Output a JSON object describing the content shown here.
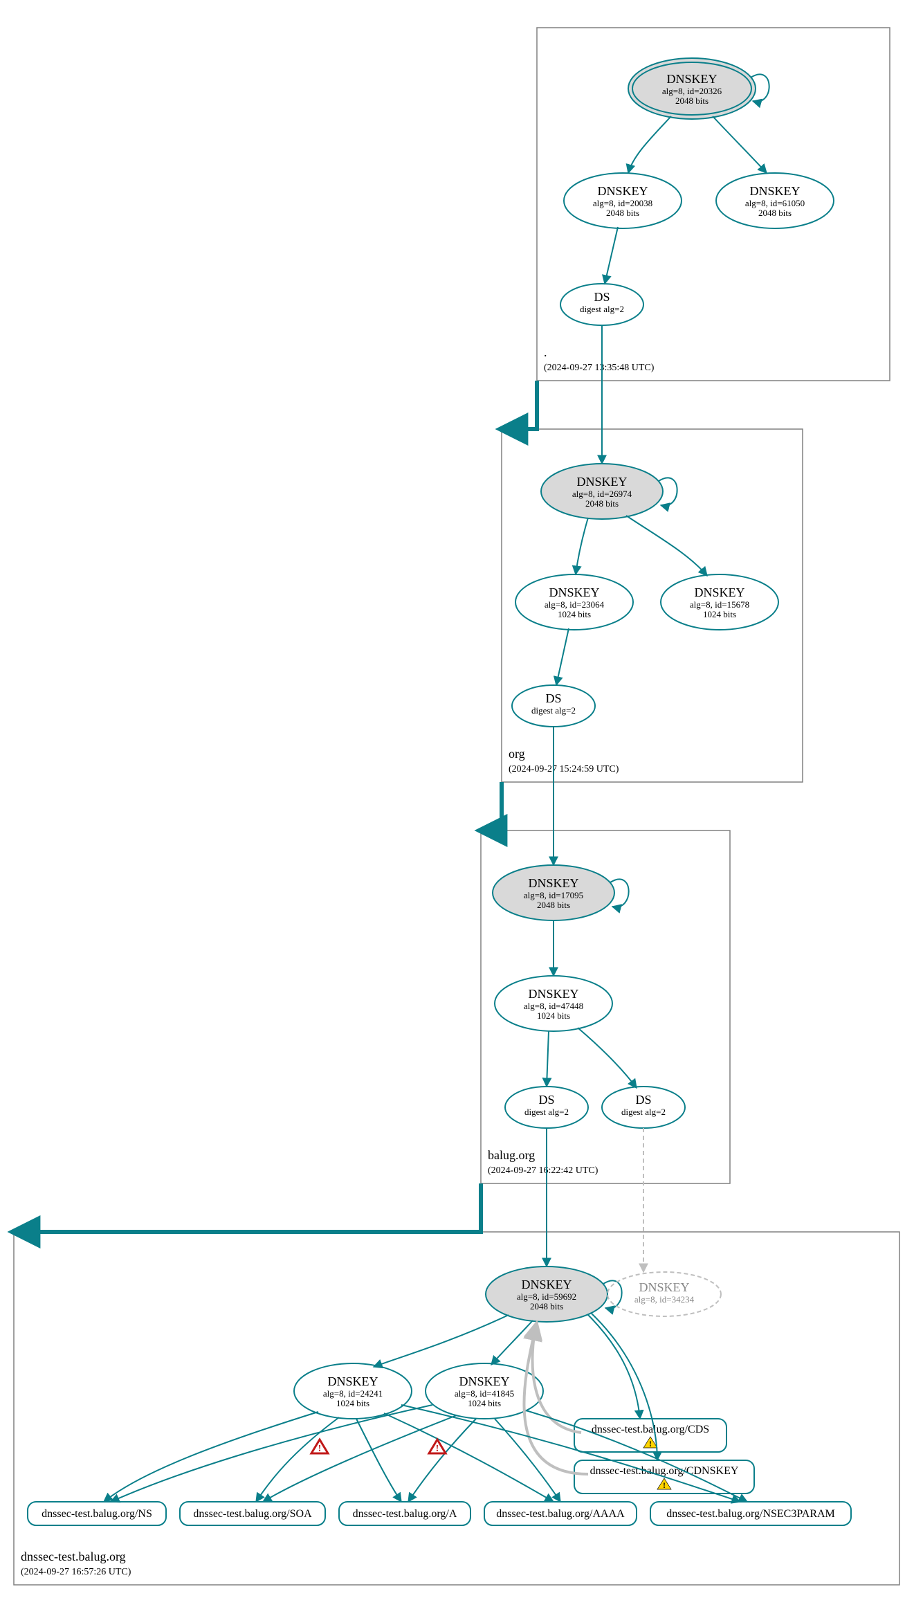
{
  "colors": {
    "teal": "#0a7f8a",
    "grayStroke": "#808080",
    "grayFill": "#d9d9d9",
    "lightGray": "#bfbfbf",
    "red": "#c01818",
    "yellow": "#ffd400"
  },
  "zones": {
    "root": {
      "name": ".",
      "timestamp": "(2024-09-27 13:35:48 UTC)"
    },
    "org": {
      "name": "org",
      "timestamp": "(2024-09-27 15:24:59 UTC)"
    },
    "balug": {
      "name": "balug.org",
      "timestamp": "(2024-09-27 16:22:42 UTC)"
    },
    "dnssec": {
      "name": "dnssec-test.balug.org",
      "timestamp": "(2024-09-27 16:57:26 UTC)"
    }
  },
  "nodes": {
    "root_ksk": {
      "title": "DNSKEY",
      "line2": "alg=8, id=20326",
      "line3": "2048 bits"
    },
    "root_zsk1": {
      "title": "DNSKEY",
      "line2": "alg=8, id=20038",
      "line3": "2048 bits"
    },
    "root_zsk2": {
      "title": "DNSKEY",
      "line2": "alg=8, id=61050",
      "line3": "2048 bits"
    },
    "root_ds": {
      "title": "DS",
      "line2": "digest alg=2"
    },
    "org_ksk": {
      "title": "DNSKEY",
      "line2": "alg=8, id=26974",
      "line3": "2048 bits"
    },
    "org_zsk1": {
      "title": "DNSKEY",
      "line2": "alg=8, id=23064",
      "line3": "1024 bits"
    },
    "org_zsk2": {
      "title": "DNSKEY",
      "line2": "alg=8, id=15678",
      "line3": "1024 bits"
    },
    "org_ds": {
      "title": "DS",
      "line2": "digest alg=2"
    },
    "balug_ksk": {
      "title": "DNSKEY",
      "line2": "alg=8, id=17095",
      "line3": "2048 bits"
    },
    "balug_zsk": {
      "title": "DNSKEY",
      "line2": "alg=8, id=47448",
      "line3": "1024 bits"
    },
    "balug_ds1": {
      "title": "DS",
      "line2": "digest alg=2"
    },
    "balug_ds2": {
      "title": "DS",
      "line2": "digest alg=2"
    },
    "dnssec_ksk": {
      "title": "DNSKEY",
      "line2": "alg=8, id=59692",
      "line3": "2048 bits"
    },
    "dnssec_grey": {
      "title": "DNSKEY",
      "line2": "alg=8, id=34234"
    },
    "dnssec_zsk1": {
      "title": "DNSKEY",
      "line2": "alg=8, id=24241",
      "line3": "1024 bits"
    },
    "dnssec_zsk2": {
      "title": "DNSKEY",
      "line2": "alg=8, id=41845",
      "line3": "1024 bits"
    },
    "rr_cds": {
      "label": "dnssec-test.balug.org/CDS"
    },
    "rr_cdnskey": {
      "label": "dnssec-test.balug.org/CDNSKEY"
    },
    "rr_ns": {
      "label": "dnssec-test.balug.org/NS"
    },
    "rr_soa": {
      "label": "dnssec-test.balug.org/SOA"
    },
    "rr_a": {
      "label": "dnssec-test.balug.org/A"
    },
    "rr_aaaa": {
      "label": "dnssec-test.balug.org/AAAA"
    },
    "rr_nsec3": {
      "label": "dnssec-test.balug.org/NSEC3PARAM"
    }
  }
}
